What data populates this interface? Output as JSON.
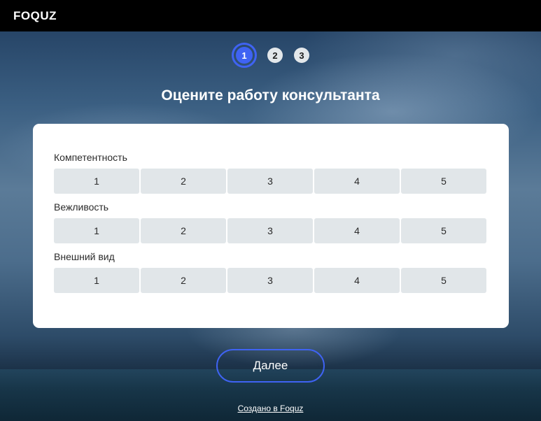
{
  "brand": {
    "logo": "FOQUZ"
  },
  "steps": [
    {
      "number": "1",
      "active": true
    },
    {
      "number": "2",
      "active": false
    },
    {
      "number": "3",
      "active": false
    }
  ],
  "title": "Оцените работу консультанта",
  "questions": [
    {
      "label": "Компетентность",
      "options": [
        "1",
        "2",
        "3",
        "4",
        "5"
      ]
    },
    {
      "label": "Вежливость",
      "options": [
        "1",
        "2",
        "3",
        "4",
        "5"
      ]
    },
    {
      "label": "Внешний вид",
      "options": [
        "1",
        "2",
        "3",
        "4",
        "5"
      ]
    }
  ],
  "next_button": "Далее",
  "footer_link": "Создано в Foquz",
  "colors": {
    "accent": "#3f63f3",
    "option_bg": "#e1e6e9",
    "topbar": "#000000"
  }
}
